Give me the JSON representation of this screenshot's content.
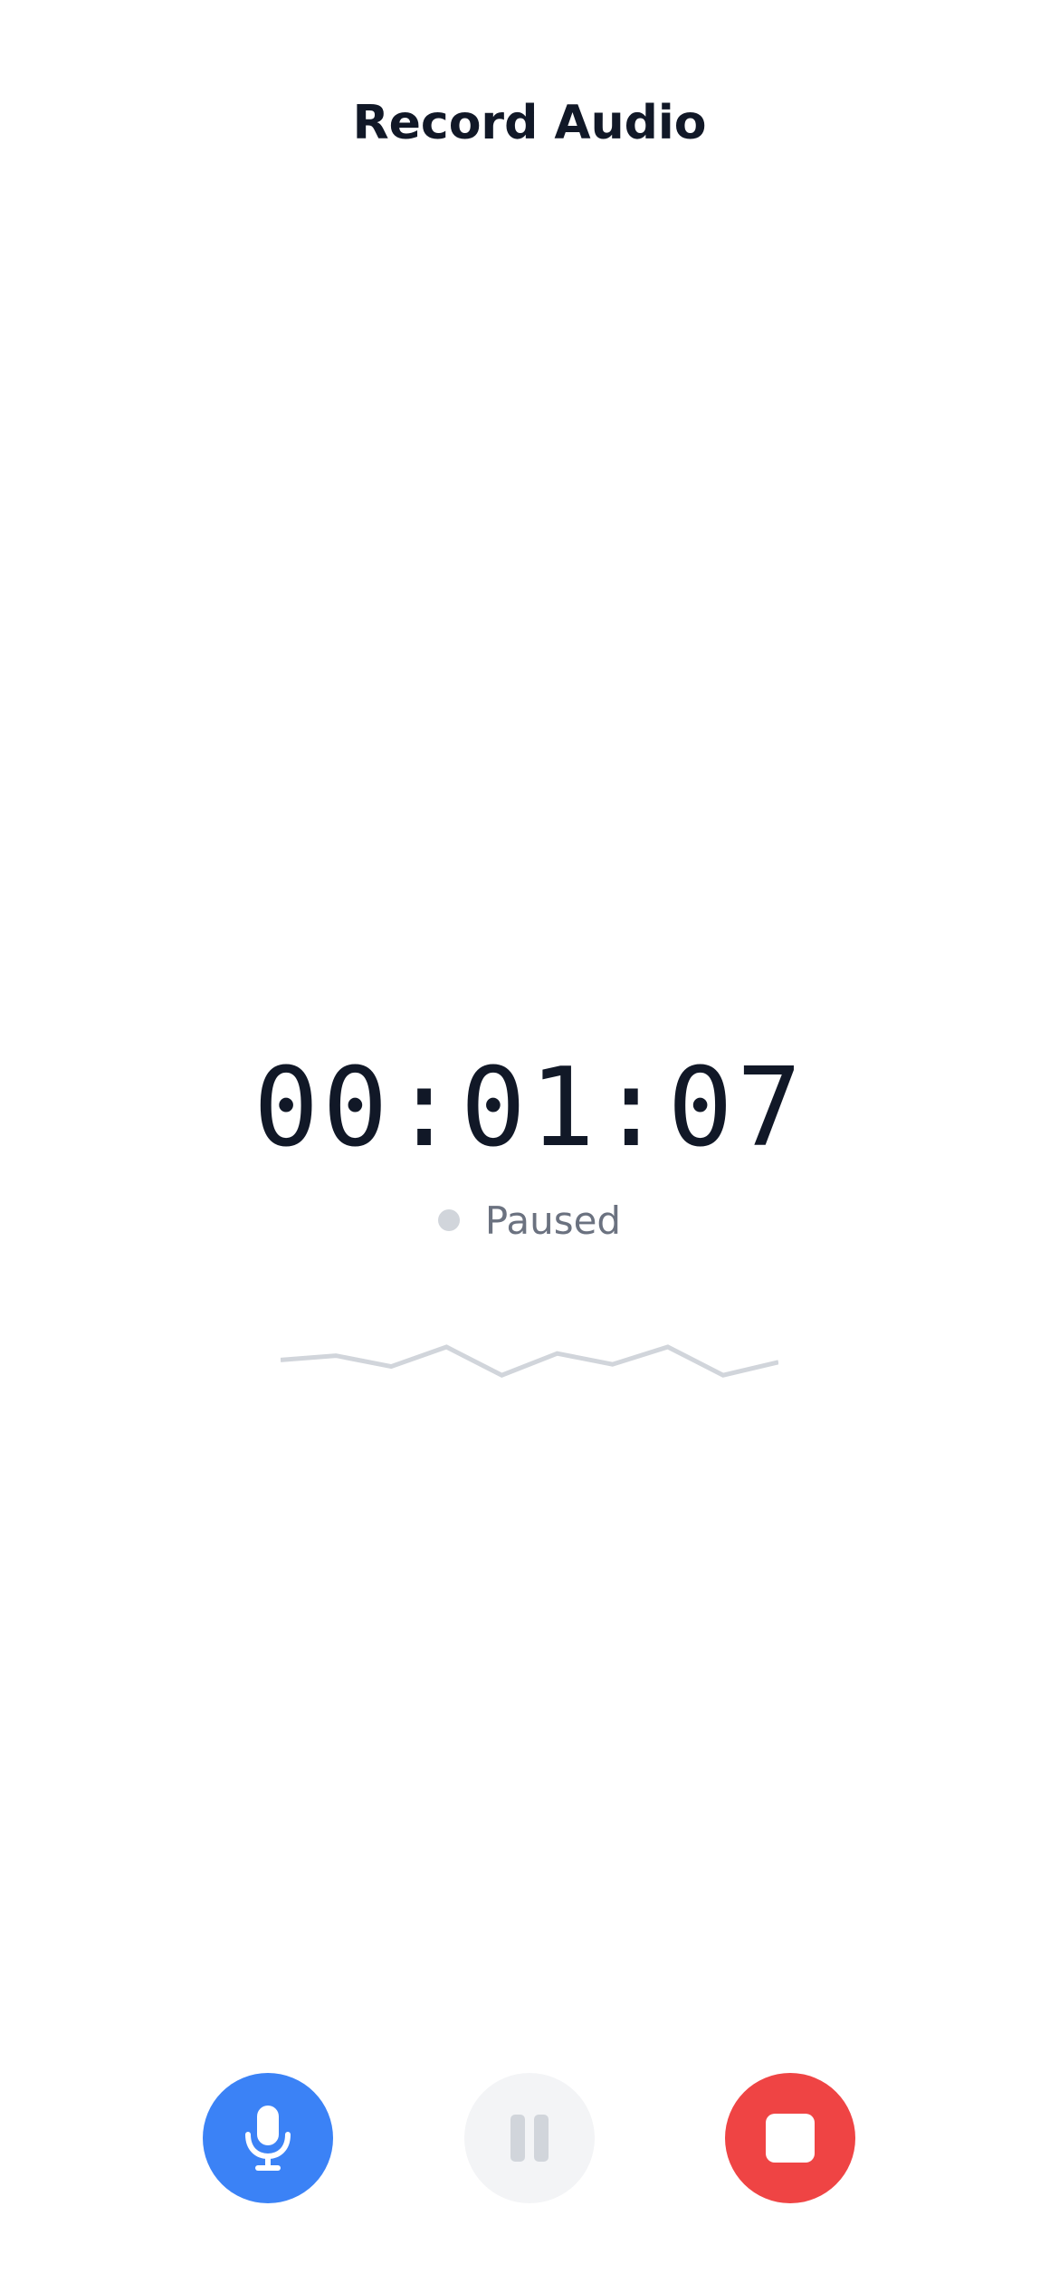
{
  "header": {
    "title": "Record Audio"
  },
  "recorder": {
    "elapsed": "00:01:07",
    "status_label": "Paused",
    "status_color": "#d1d5db",
    "waveform_levels": [
      0.45,
      0.55,
      0.3,
      0.75,
      0.1,
      0.6,
      0.35,
      0.75,
      0.1,
      0.4
    ]
  },
  "controls": {
    "record": {
      "icon": "microphone-icon",
      "color": "#3b82f6",
      "icon_color": "#ffffff"
    },
    "pause": {
      "icon": "pause-icon",
      "color": "#f3f4f6",
      "icon_color": "#d1d5db",
      "enabled": false
    },
    "stop": {
      "icon": "stop-icon",
      "color": "#ef4444",
      "icon_color": "#ffffff"
    }
  }
}
